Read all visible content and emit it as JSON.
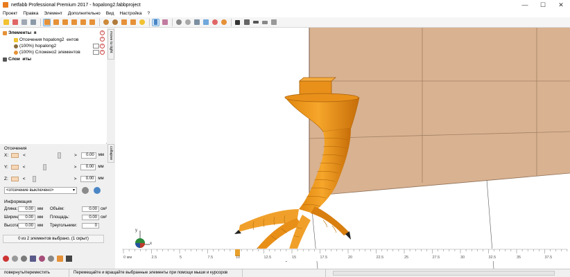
{
  "window": {
    "title": "netfabb Professional Premium 2017 - hopalong2.fabbproject",
    "minimize": "—",
    "maximize": "☐",
    "close": "✕"
  },
  "menu": [
    "Проект",
    "Правка",
    "Элемент",
    "Дополнительно",
    "Вид",
    "Настройка",
    "?"
  ],
  "tree": {
    "elements_label": "Элементы",
    "elements_suffix": "я",
    "cuts_label": "Отсечения hopalong2",
    "cuts_suffix": "ентов",
    "item1": "(100%) hopalong2",
    "item2": "(100%) Сложено2 элементов",
    "layers_label": "Слои",
    "layers_suffix": "иты"
  },
  "side_tabs": {
    "tab1": "move to tight",
    "tab2": "collapse"
  },
  "cut": {
    "title": "Отсечения",
    "axes": [
      {
        "name": "X:",
        "value": "0.00",
        "unit": "мм",
        "slider": 0.72
      },
      {
        "name": "Y:",
        "value": "0.00",
        "unit": "мм",
        "slider": 0.36
      },
      {
        "name": "Z:",
        "value": "0.00",
        "unit": "мм",
        "slider": 0.08
      }
    ],
    "lt": "<",
    "gt": ">",
    "mode": "<отсечение выключено>"
  },
  "info": {
    "title": "Информация",
    "length_label": "Длина:",
    "length_value": "0.00",
    "width_label": "Ширина:",
    "width_value": "0.00",
    "height_label": "Высота:",
    "height_value": "0.00",
    "mm": "мм",
    "volume_label": "Объём:",
    "volume_value": "0.00",
    "volume_unit": "см³",
    "area_label": "Площадь:",
    "area_value": "0.00",
    "area_unit": "см²",
    "triangles_label": "Треугольники:",
    "triangles_value": "0"
  },
  "selection_status": "0 из 2 элементов выбрано. (1 скрыт)",
  "ruler": {
    "labels": [
      "0 мм",
      "2.5",
      "5",
      "7.5",
      "10",
      "12.5",
      "15",
      "17.5",
      "20",
      "22.5",
      "25",
      "27.5",
      "30",
      "32.5",
      "35",
      "37.5"
    ]
  },
  "axes_gizmo": {
    "x": "x",
    "y": "y"
  },
  "statusbar": {
    "mode": "повернуть/переместить",
    "hint": "Перемещайте и вращайте выбранные элементы при помощи мыши и курсоров клавиатуры"
  },
  "colors": {
    "model": "#f39a1c",
    "model_dark": "#c9730a",
    "plate": "#d9b291",
    "accent": "#e87b1e"
  }
}
